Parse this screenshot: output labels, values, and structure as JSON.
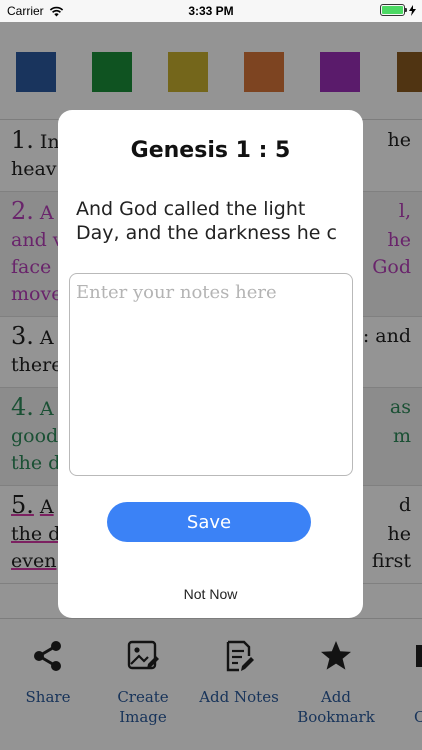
{
  "status_bar": {
    "carrier": "Carrier",
    "time": "3:33 PM",
    "battery_level": 1.0,
    "battery_color": "#4cd964"
  },
  "color_swatches": [
    "#2c5aa0",
    "#1a8f3a",
    "#c8b030",
    "#d8763a",
    "#9b30b8",
    "#8a5a20"
  ],
  "verses": [
    {
      "num": "1.",
      "lines": [
        "In",
        "heav"
      ],
      "color": "#222222",
      "right_fragments": [
        "he",
        ""
      ]
    },
    {
      "num": "2.",
      "lines": [
        "A",
        "and v",
        "face",
        "move"
      ],
      "color": "#b63fb8",
      "right_fragments": [
        "l,",
        "he",
        "God",
        ""
      ]
    },
    {
      "num": "3.",
      "lines": [
        "A",
        "there"
      ],
      "color": "#222222",
      "right_fragments": [
        ": and",
        ""
      ]
    },
    {
      "num": "4.",
      "lines": [
        "A",
        "good",
        "the d"
      ],
      "color": "#2e8a5a",
      "right_fragments": [
        "as",
        "m",
        ""
      ]
    },
    {
      "num": "5.",
      "lines": [
        "A",
        "the d",
        "even"
      ],
      "color": "#222222",
      "right_fragments": [
        "d",
        "he",
        "first"
      ]
    }
  ],
  "toolbar": {
    "items": [
      {
        "name": "share",
        "label": "Share",
        "icon": "share-icon"
      },
      {
        "name": "create-image",
        "label": "Create\nImage",
        "icon": "image-edit-icon"
      },
      {
        "name": "add-notes",
        "label": "Add Notes",
        "icon": "notes-edit-icon"
      },
      {
        "name": "add-bookmark",
        "label": "Add\nBookmark",
        "icon": "star-icon"
      },
      {
        "name": "copy",
        "label": "C",
        "icon": "copy-icon"
      }
    ],
    "label_color": "#2a5a9c"
  },
  "modal": {
    "title": "Genesis 1 : 5",
    "verse_text_line1": "And God called the light",
    "verse_text_line2": "Day, and the darkness he c",
    "notes_placeholder": "Enter your notes here",
    "notes_value": "",
    "save_label": "Save",
    "not_now_label": "Not Now",
    "accent_color": "#3b82f6"
  }
}
